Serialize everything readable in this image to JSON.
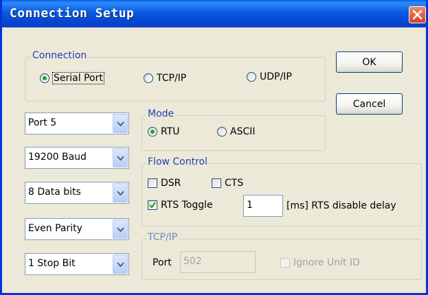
{
  "window": {
    "title": "Connection Setup",
    "close_icon": "close-icon"
  },
  "buttons": {
    "ok": "OK",
    "cancel": "Cancel"
  },
  "connection": {
    "legend": "Connection",
    "options": [
      {
        "label": "Serial Port",
        "selected": true
      },
      {
        "label": "TCP/IP",
        "selected": false
      },
      {
        "label": "UDP/IP",
        "selected": false
      }
    ]
  },
  "serial": {
    "port": "Port 5",
    "baud": "19200 Baud",
    "data_bits": "8 Data bits",
    "parity": "Even Parity",
    "stop_bits": "1 Stop Bit"
  },
  "mode": {
    "legend": "Mode",
    "options": [
      {
        "label": "RTU",
        "selected": true
      },
      {
        "label": "ASCII",
        "selected": false
      }
    ]
  },
  "flow_control": {
    "legend": "Flow Control",
    "dsr": {
      "label": "DSR",
      "checked": false
    },
    "cts": {
      "label": "CTS",
      "checked": false
    },
    "rts_toggle": {
      "label": "RTS Toggle",
      "checked": true
    },
    "rts_delay_value": "1",
    "rts_delay_label": "[ms] RTS disable delay"
  },
  "tcpip": {
    "legend": "TCP/IP",
    "port_label": "Port",
    "port_value": "502",
    "ignore_unit_id": {
      "label": "Ignore Unit ID",
      "checked": false
    }
  },
  "colors": {
    "title_bar": "#0a5ae0",
    "legend_text": "#1f3fb8",
    "dialog_bg": "#ece9d8",
    "selected_dot": "#21a121",
    "check_mark": "#21a121"
  }
}
